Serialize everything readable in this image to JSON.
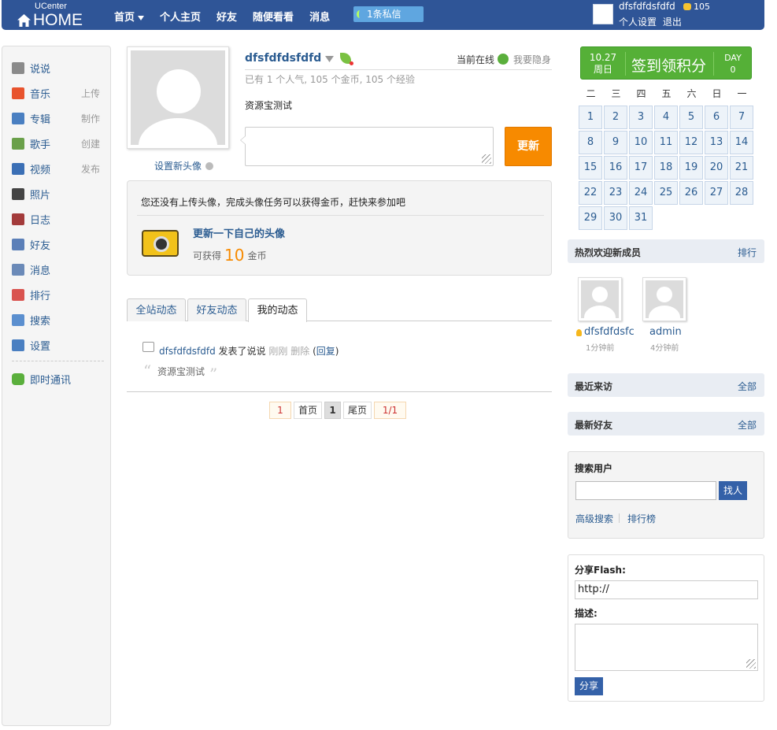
{
  "header": {
    "logo_small": "UCenter",
    "logo_big": "HOME",
    "nav": [
      "首页",
      "个人主页",
      "好友",
      "随便看看",
      "消息"
    ],
    "pm_label": "1条私信",
    "username": "dfsfdfdsfdfd",
    "coins": "105",
    "settings_link": "个人设置",
    "logout_link": "退出"
  },
  "sidebar": {
    "items": [
      {
        "label": "说说",
        "sub": "",
        "color": "#8a8a8a"
      },
      {
        "label": "音乐",
        "sub": "上传",
        "color": "#e8532d"
      },
      {
        "label": "专辑",
        "sub": "制作",
        "color": "#4a7fc1"
      },
      {
        "label": "歌手",
        "sub": "创建",
        "color": "#6aa04a"
      },
      {
        "label": "视频",
        "sub": "发布",
        "color": "#3b6fb5"
      },
      {
        "label": "照片",
        "sub": "",
        "color": "#444444"
      },
      {
        "label": "日志",
        "sub": "",
        "color": "#a33b3b"
      },
      {
        "label": "好友",
        "sub": "",
        "color": "#5b7fb8"
      },
      {
        "label": "消息",
        "sub": "",
        "color": "#6b8ab8"
      },
      {
        "label": "排行",
        "sub": "",
        "color": "#d9534f"
      },
      {
        "label": "搜索",
        "sub": "",
        "color": "#5b8fcf"
      },
      {
        "label": "设置",
        "sub": "",
        "color": "#4a7fc1"
      }
    ],
    "im_label": "即时通讯"
  },
  "profile": {
    "name": "dfsfdfdsfdfd",
    "online": "当前在线",
    "hide": "我要隐身",
    "stats": "已有 1 个人气, 105 个金币, 105 个经验",
    "status": "资源宝测试",
    "set_avatar": "设置新头像",
    "update_btn": "更新"
  },
  "task": {
    "notice": "您还没有上传头像，完成头像任务可以获得金币，赶快来参加吧",
    "title": "更新一下自己的头像",
    "reward_prefix": "可获得",
    "reward_num": "10",
    "reward_unit": "金币"
  },
  "tabs": [
    "全站动态",
    "好友动态",
    "我的动态"
  ],
  "feed": {
    "user": "dfsfdfdsfdfd",
    "action": "发表了说说",
    "time": "刚刚",
    "delete": "删除",
    "reply_open": "(",
    "reply": "回复",
    "reply_close": ")",
    "text": "资源宝测试"
  },
  "pager": {
    "first_num": "1",
    "first": "首页",
    "current": "1",
    "last": "尾页",
    "total": "1/1"
  },
  "checkin": {
    "date": "10.27",
    "weekday": "周日",
    "title": "签到领积分",
    "day_label": "DAY",
    "day_count": "0"
  },
  "calendar": {
    "weekdays": [
      "二",
      "三",
      "四",
      "五",
      "六",
      "日",
      "一"
    ],
    "days": [
      "1",
      "2",
      "3",
      "4",
      "5",
      "6",
      "7",
      "8",
      "9",
      "10",
      "11",
      "12",
      "13",
      "14",
      "15",
      "16",
      "17",
      "18",
      "19",
      "20",
      "21",
      "22",
      "23",
      "24",
      "25",
      "26",
      "27",
      "28",
      "29",
      "30",
      "31"
    ]
  },
  "new_members": {
    "title": "热烈欢迎新成员",
    "more": "排行",
    "members": [
      {
        "name": "dfsfdfdsfc",
        "time": "1分钟前"
      },
      {
        "name": "admin",
        "time": "4分钟前"
      }
    ]
  },
  "recent_visitors": {
    "title": "最近来访",
    "more": "全部"
  },
  "recent_friends": {
    "title": "最新好友",
    "more": "全部"
  },
  "search": {
    "title": "搜索用户",
    "button": "找人",
    "advanced": "高级搜索",
    "ranking": "排行榜"
  },
  "share": {
    "title": "分享Flash:",
    "url_value": "http://",
    "desc_label": "描述:",
    "button": "分享"
  }
}
